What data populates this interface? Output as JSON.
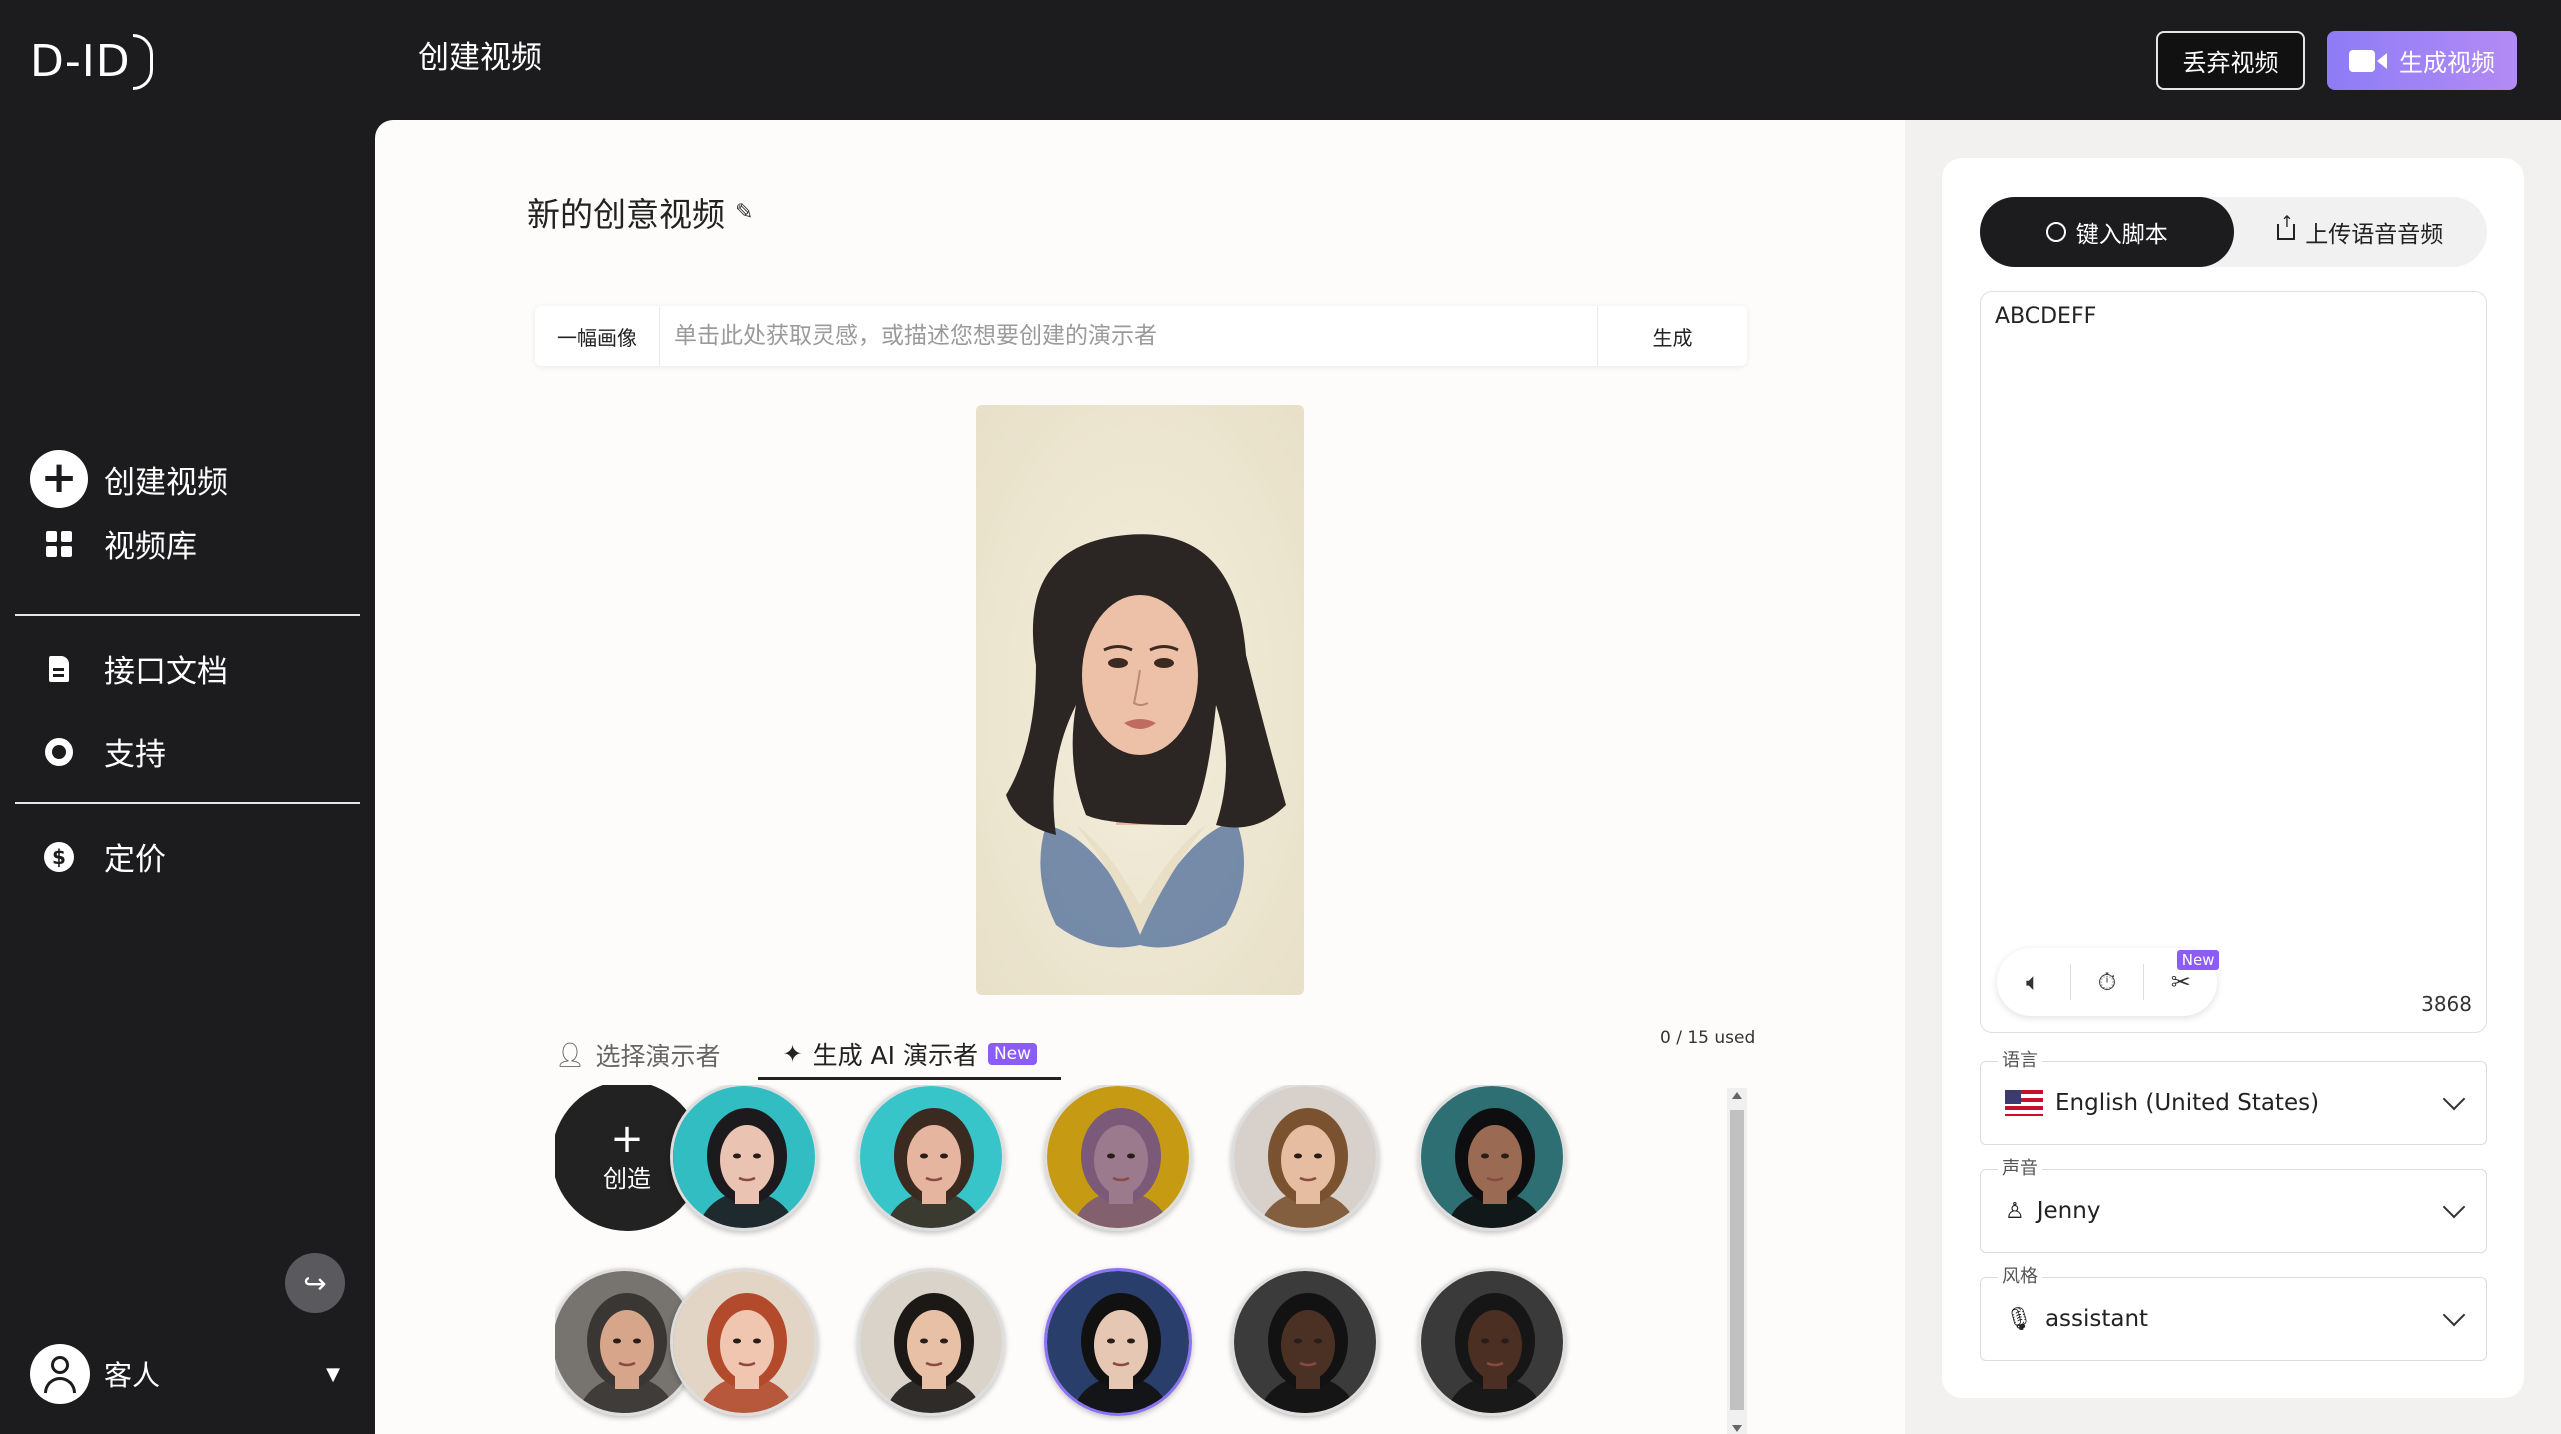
{
  "header": {
    "logo": "D-ID",
    "title": "创建视频",
    "discard_label": "丢弃视频",
    "generate_label": "生成视频"
  },
  "sidebar": {
    "items": [
      {
        "label": "创建视频",
        "icon": "plus-circle-icon"
      },
      {
        "label": "视频库",
        "icon": "grid-icon"
      },
      {
        "label": "接口文档",
        "icon": "document-icon"
      },
      {
        "label": "支持",
        "icon": "lifebuoy-icon"
      },
      {
        "label": "定价",
        "icon": "dollar-icon"
      }
    ],
    "collapse_icon": "collapse-arrow-icon",
    "user_label": "客人"
  },
  "editor": {
    "video_title": "新的创意视频",
    "prompt_kind": "一幅画像",
    "prompt_placeholder": "单击此处获取灵感，或描述您想要创建的演示者",
    "prompt_button": "生成",
    "tabs": [
      {
        "label": "选择演示者",
        "active": false
      },
      {
        "label": "生成 AI 演示者",
        "active": true,
        "badge": "New"
      }
    ],
    "usage": "0 / 15 used",
    "create_label": "创造",
    "create_plus": "+",
    "presenters": [
      {
        "name": "presenter-1"
      },
      {
        "name": "presenter-2"
      },
      {
        "name": "presenter-3"
      },
      {
        "name": "presenter-4"
      },
      {
        "name": "presenter-5"
      },
      {
        "name": "presenter-6"
      },
      {
        "name": "presenter-7"
      },
      {
        "name": "presenter-8"
      },
      {
        "name": "presenter-9",
        "selected": true
      },
      {
        "name": "presenter-10"
      },
      {
        "name": "presenter-11"
      }
    ]
  },
  "script_panel": {
    "tabs": [
      {
        "label": "键入脚本",
        "active": true
      },
      {
        "label": "上传语音音频",
        "active": false
      }
    ],
    "script_text": "ABCDEFF",
    "tools_new_badge": "New",
    "char_count": "3868",
    "language_label": "语言",
    "language_value": "English (United States)",
    "voice_label": "声音",
    "voice_value": "Jenny",
    "style_label": "风格",
    "style_value": "assistant"
  },
  "colors": {
    "accent": "#8c72f4",
    "dark_bg": "#1c1c1f"
  }
}
